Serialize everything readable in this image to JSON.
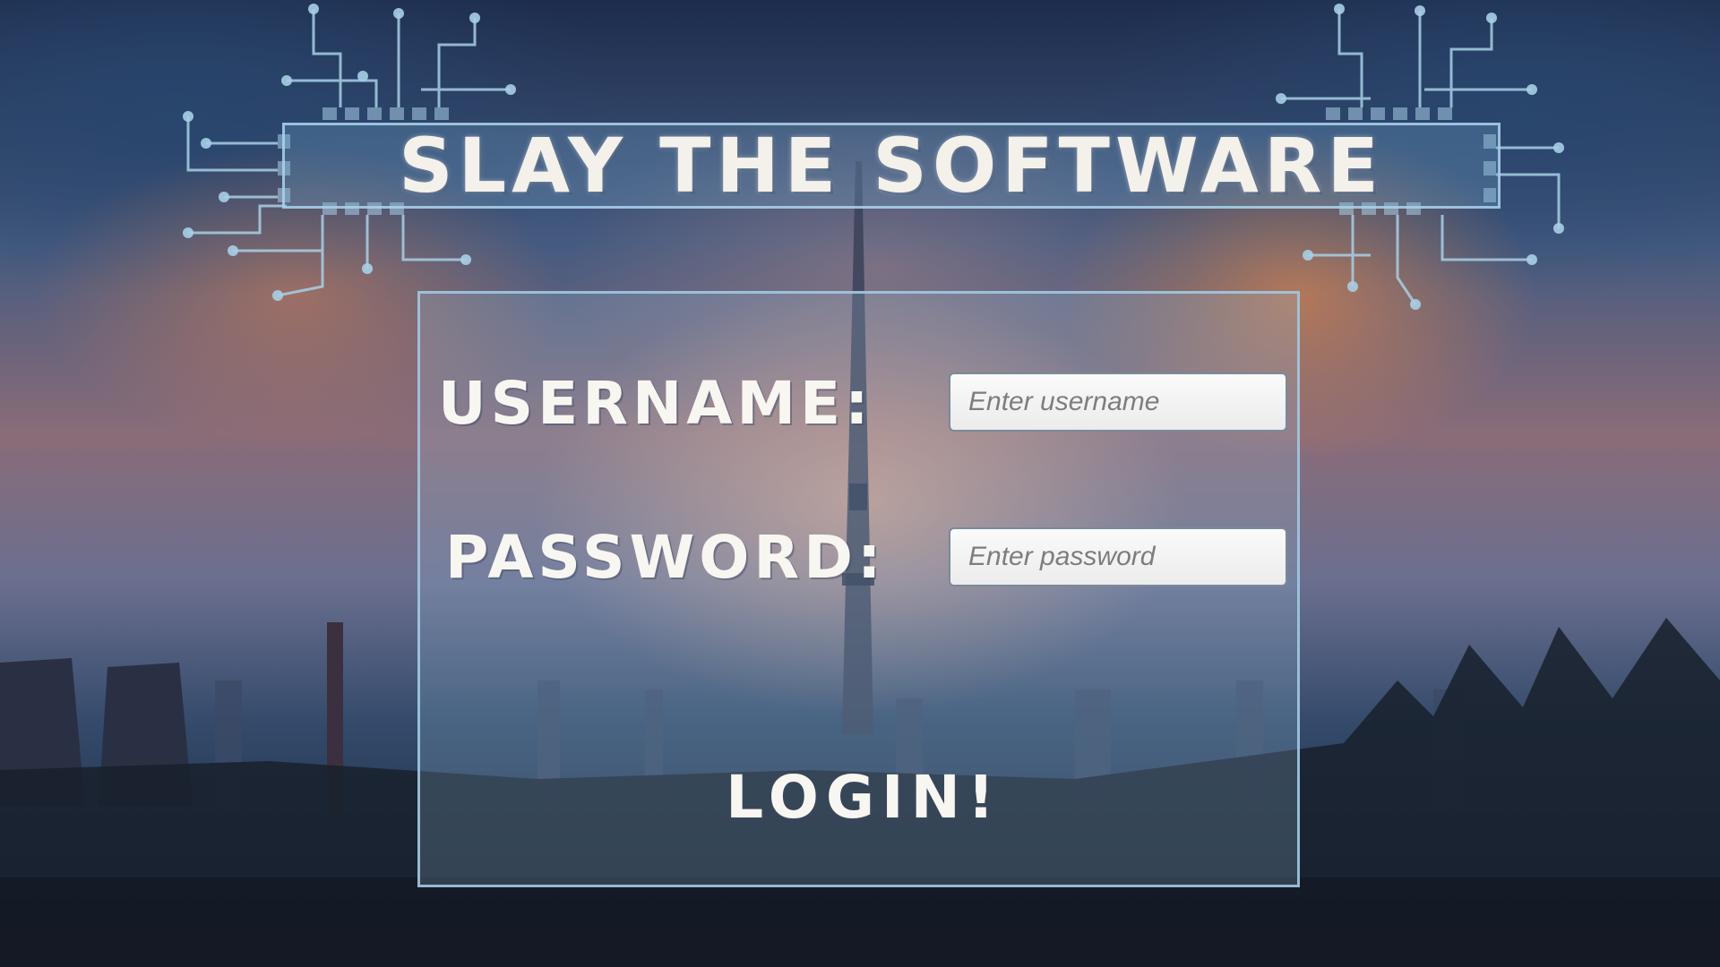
{
  "title": "SLAY THE SOFTWARE",
  "login_form": {
    "username_label": "USERNAME:",
    "username_placeholder": "Enter username",
    "username_value": "",
    "password_label": "PASSWORD:",
    "password_placeholder": "Enter password",
    "password_value": "",
    "submit_label": "LOGIN!"
  },
  "colors": {
    "panel_border": "#a0c8e1",
    "text": "#f8f6f0",
    "circuit": "#a8cfe6"
  },
  "decorations": {
    "left": "circuit-board-icon",
    "right": "circuit-board-icon"
  }
}
